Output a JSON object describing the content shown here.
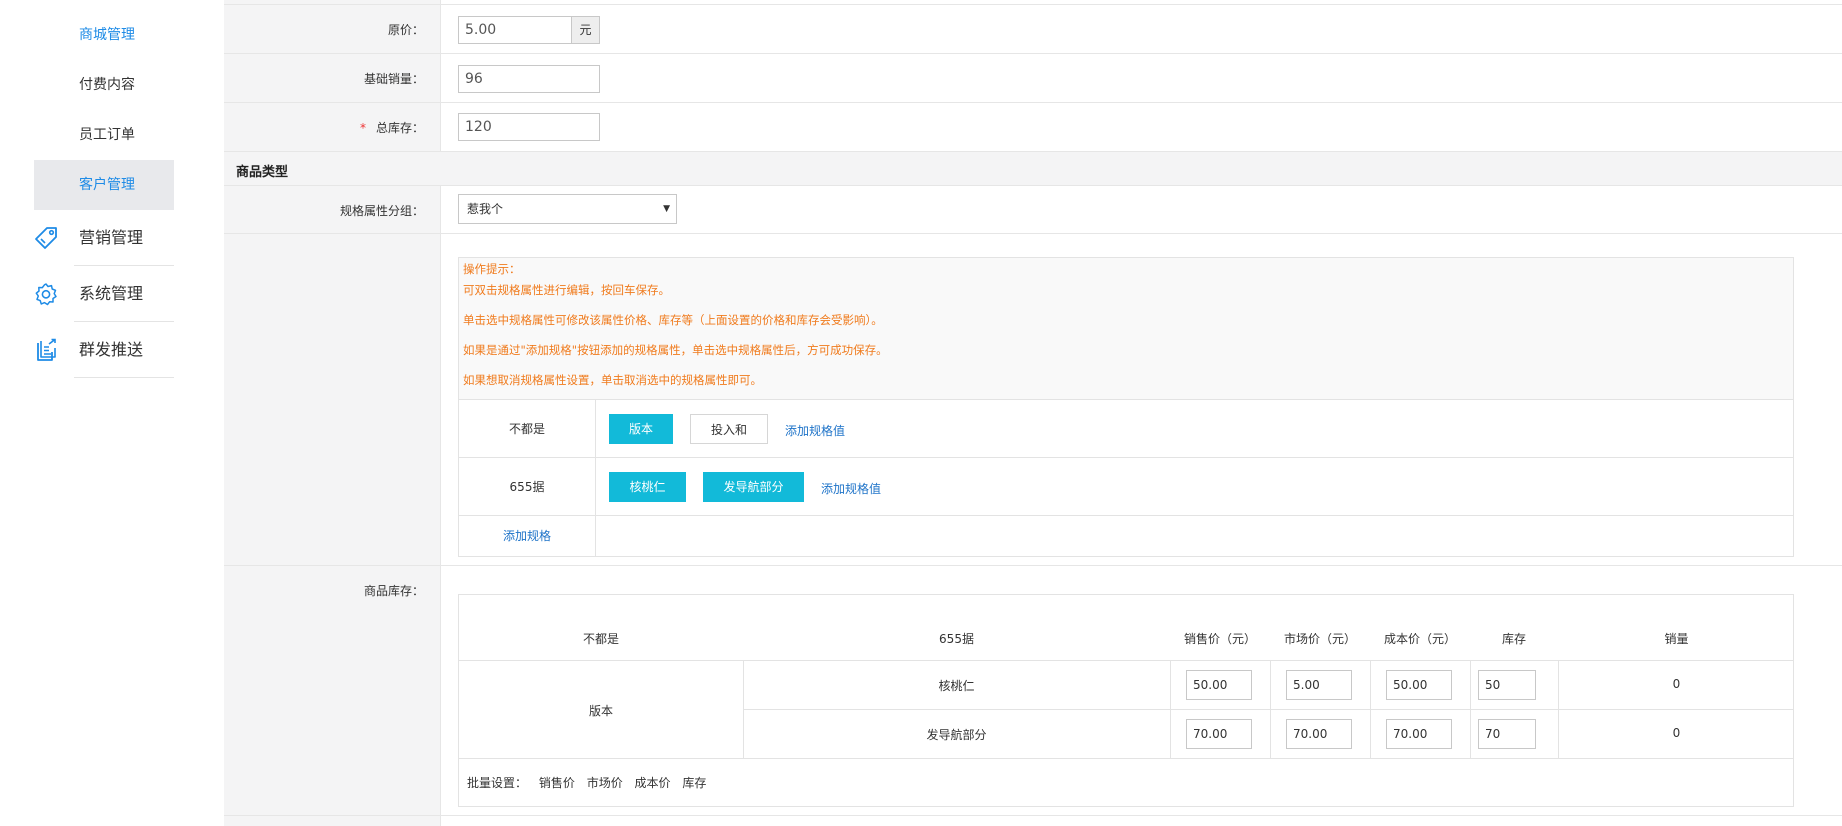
{
  "sidebar": {
    "sub_items": [
      "商城管理",
      "付费内容",
      "员工订单",
      "客户管理"
    ],
    "main_items": [
      "营销管理",
      "系统管理",
      "群发推送"
    ]
  },
  "form": {
    "original_price_label": "原价：",
    "original_price_value": "5.00",
    "unit": "元",
    "base_sales_label": "基础销量：",
    "base_sales_value": "96",
    "required_mark": "*",
    "total_stock_label": "总库存：",
    "total_stock_value": "120",
    "section_title": "商品类型",
    "spec_group_label": "规格属性分组：",
    "spec_group_selected": "惹我个",
    "stock_label": "商品库存："
  },
  "hint": {
    "title": "操作提示：",
    "lines": [
      "可双击规格属性进行编辑，按回车保存。",
      "单击选中规格属性可修改该属性价格、库存等（上面设置的价格和库存会受影响）。",
      "如果是通过\"添加规格\"按钮添加的规格属性，单击选中规格属性后，方可成功保存。",
      "如果想取消规格属性设置，单击取消选中的规格属性即可。"
    ]
  },
  "specs": {
    "rows": [
      {
        "name": "不都是",
        "values": [
          "版本",
          "投入和"
        ],
        "add_label": "添加规格值"
      },
      {
        "name": "655据",
        "values": [
          "核桃仁",
          "发导航部分"
        ],
        "add_label": "添加规格值"
      }
    ],
    "add_spec_label": "添加规格"
  },
  "inventory": {
    "headers": [
      "不都是",
      "655据",
      "销售价（元）",
      "市场价（元）",
      "成本价（元）",
      "库存",
      "销量"
    ],
    "group_label": "版本",
    "rows": [
      {
        "spec": "核桃仁",
        "sale": "50.00",
        "market": "5.00",
        "cost": "50.00",
        "stock": "50",
        "sold": "0"
      },
      {
        "spec": "发导航部分",
        "sale": "70.00",
        "market": "70.00",
        "cost": "70.00",
        "stock": "70",
        "sold": "0"
      }
    ],
    "bulk_label": "批量设置：",
    "bulk_options": [
      "销售价",
      "市场价",
      "成本价",
      "库存"
    ]
  },
  "colors": {
    "accent": "#1e8be6",
    "chip_active": "#12bad9",
    "hint_text": "#f07b1d",
    "link": "#1e73c8"
  }
}
